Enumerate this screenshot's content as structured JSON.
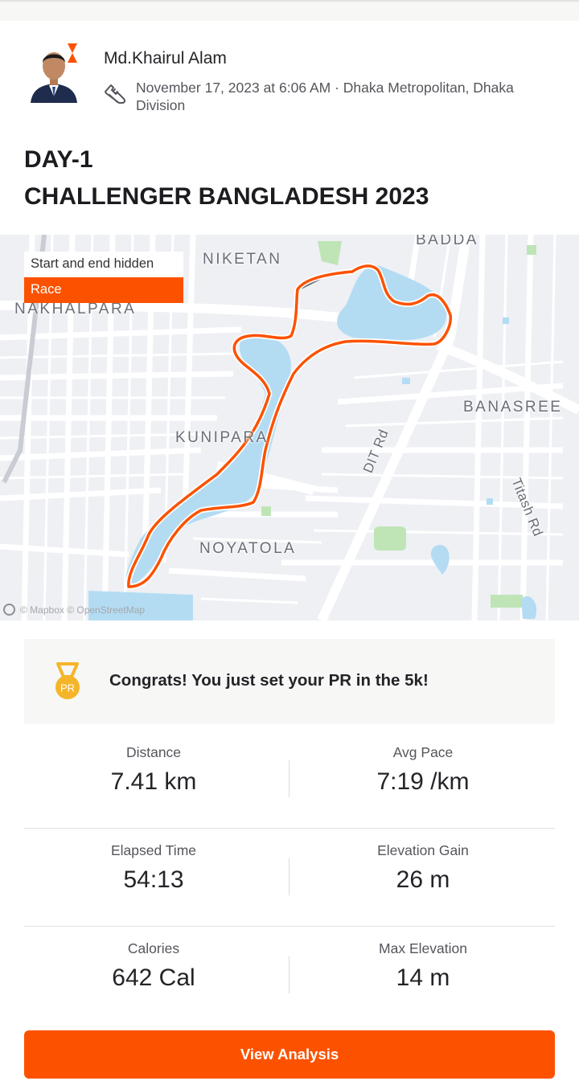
{
  "athlete": {
    "name": "Md.Khairul Alam",
    "date_time": "November 17, 2023 at 6:06 AM",
    "separator": " · ",
    "location": "Dhaka Metropolitan, Dhaka Division",
    "activity_icon": "running-shoe-icon",
    "avatar_badge_icon": "strava-chevron-icon"
  },
  "activity": {
    "title_line1": "DAY-1",
    "title_line2": "CHALLENGER BANGLADESH 2023"
  },
  "map": {
    "hidden_label": "Start and end hidden",
    "race_label": "Race",
    "places": [
      "BADDA",
      "NIKETAN",
      "NAKHALPARA",
      "BANASREE",
      "KUNIPARA",
      "NOYATOLA"
    ],
    "roads": [
      "DIT Rd",
      "Titash Rd"
    ],
    "attribution": "© Mapbox © OpenStreetMap",
    "route_color": "#fc5200",
    "water_color": "#b3dcf3"
  },
  "pr": {
    "icon": "pr-medal-icon",
    "medal_label": "PR",
    "message": "Congrats! You just set your PR in the 5k!"
  },
  "stats": {
    "distance": {
      "label": "Distance",
      "value": "7.41 km"
    },
    "avg_pace": {
      "label": "Avg Pace",
      "value": "7:19 /km"
    },
    "elapsed_time": {
      "label": "Elapsed Time",
      "value": "54:13"
    },
    "elevation_gain": {
      "label": "Elevation Gain",
      "value": "26 m"
    },
    "calories": {
      "label": "Calories",
      "value": "642 Cal"
    },
    "max_elevation": {
      "label": "Max Elevation",
      "value": "14 m"
    }
  },
  "actions": {
    "view_analysis": "View Analysis"
  },
  "colors": {
    "accent": "#fc5200",
    "text": "#242428",
    "muted": "#55555c"
  }
}
